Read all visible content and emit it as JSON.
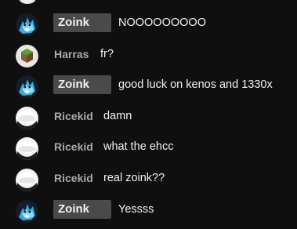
{
  "messages": [
    {
      "author": "Zoink",
      "text": "NOOOOOOOOO",
      "avatar": "blue-monster-avatar",
      "highlighted": true
    },
    {
      "author": "Harras",
      "text": "fr?",
      "avatar": "minecraft-grass-block-avatar",
      "highlighted": false
    },
    {
      "author": "Zoink",
      "text": "good luck on kenos and 1330x",
      "avatar": "blue-monster-avatar",
      "highlighted": true
    },
    {
      "author": "Ricekid",
      "text": "damn",
      "avatar": "rice-bowl-avatar",
      "highlighted": false
    },
    {
      "author": "Ricekid",
      "text": "what the ehcc",
      "avatar": "rice-bowl-avatar",
      "highlighted": false
    },
    {
      "author": "Ricekid",
      "text": "real zoink??",
      "avatar": "rice-bowl-avatar",
      "highlighted": false
    },
    {
      "author": "Zoink",
      "text": "Yessss",
      "avatar": "blue-monster-avatar",
      "highlighted": true
    }
  ],
  "colors": {
    "background": "#0f0f0f",
    "badge": "#4a4a4a",
    "author": "#aaaaaa",
    "text": "#f1f1f1"
  }
}
